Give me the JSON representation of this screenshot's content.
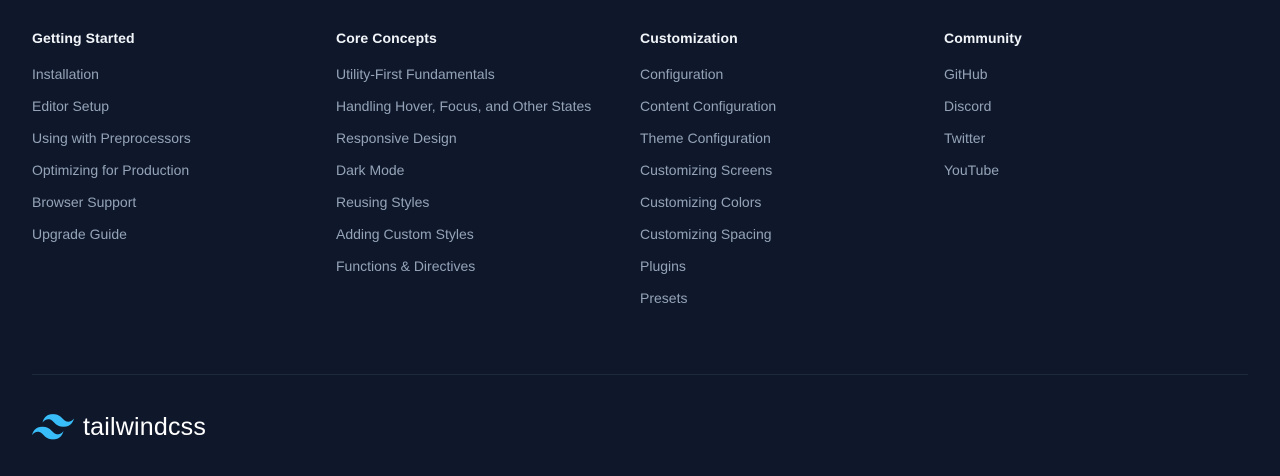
{
  "footer": {
    "columns": [
      {
        "heading": "Getting Started",
        "links": [
          "Installation",
          "Editor Setup",
          "Using with Preprocessors",
          "Optimizing for Production",
          "Browser Support",
          "Upgrade Guide"
        ]
      },
      {
        "heading": "Core Concepts",
        "links": [
          "Utility-First Fundamentals",
          "Handling Hover, Focus, and Other States",
          "Responsive Design",
          "Dark Mode",
          "Reusing Styles",
          "Adding Custom Styles",
          "Functions & Directives"
        ]
      },
      {
        "heading": "Customization",
        "links": [
          "Configuration",
          "Content Configuration",
          "Theme Configuration",
          "Customizing Screens",
          "Customizing Colors",
          "Customizing Spacing",
          "Plugins",
          "Presets"
        ]
      },
      {
        "heading": "Community",
        "links": [
          "GitHub",
          "Discord",
          "Twitter",
          "YouTube"
        ]
      }
    ],
    "brand": {
      "name": "tailwindcss",
      "logo_icon": "tailwind-wave-logo-icon"
    }
  },
  "colors": {
    "background": "#0f172a",
    "heading": "#f1f5f9",
    "link": "#94a3b8",
    "divider": "#1e293b",
    "brand_accent": "#38bdf8",
    "brand_text": "#ffffff"
  }
}
